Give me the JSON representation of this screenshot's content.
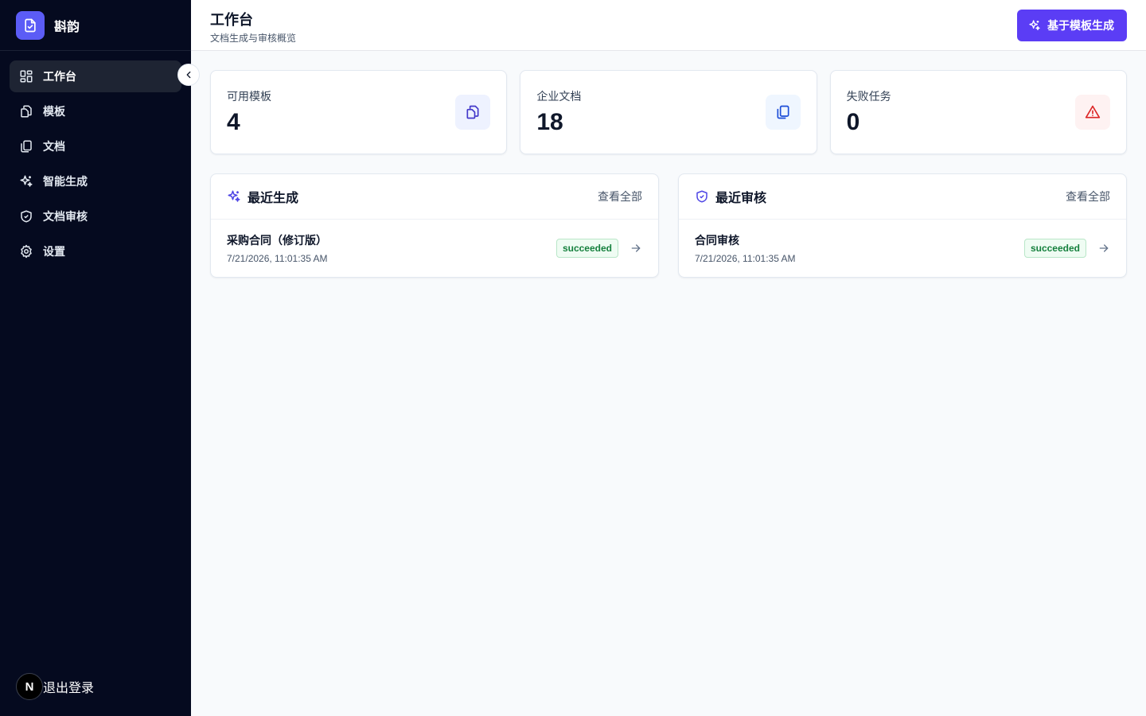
{
  "app": {
    "name": "斟韵"
  },
  "sidebar": {
    "items": [
      {
        "label": "工作台",
        "icon": "dashboard-icon",
        "active": true
      },
      {
        "label": "模板",
        "icon": "templates-icon"
      },
      {
        "label": "文档",
        "icon": "documents-icon"
      },
      {
        "label": "智能生成",
        "icon": "sparkles-icon"
      },
      {
        "label": "文档审核",
        "icon": "shield-check-icon"
      },
      {
        "label": "设置",
        "icon": "gear-icon"
      }
    ],
    "logout_label": "退出登录",
    "avatar_letter": "N"
  },
  "header": {
    "title": "工作台",
    "subtitle": "文档生成与审核概览",
    "primary_button": "基于模板生成"
  },
  "stats": [
    {
      "label": "可用模板",
      "value": "4",
      "icon": "templates-icon",
      "color": "#4f46e5",
      "bg": "#eef2ff"
    },
    {
      "label": "企业文档",
      "value": "18",
      "icon": "documents-icon",
      "color": "#2563eb",
      "bg": "#eff6ff"
    },
    {
      "label": "失败任务",
      "value": "0",
      "icon": "alert-triangle-icon",
      "color": "#dc2626",
      "bg": "#fef2f2"
    }
  ],
  "recent_generation": {
    "title": "最近生成",
    "view_all": "查看全部",
    "rows": [
      {
        "title": "采购合同（修订版）",
        "time": "7/21/2026, 11:01:35 AM",
        "status": "succeeded"
      }
    ]
  },
  "recent_review": {
    "title": "最近审核",
    "view_all": "查看全部",
    "rows": [
      {
        "title": "合同审核",
        "time": "7/21/2026, 11:01:35 AM",
        "status": "succeeded"
      }
    ]
  },
  "colors": {
    "sidebar_bg": "#050a1f",
    "accent": "#5b3df5",
    "success": "#15803d"
  }
}
